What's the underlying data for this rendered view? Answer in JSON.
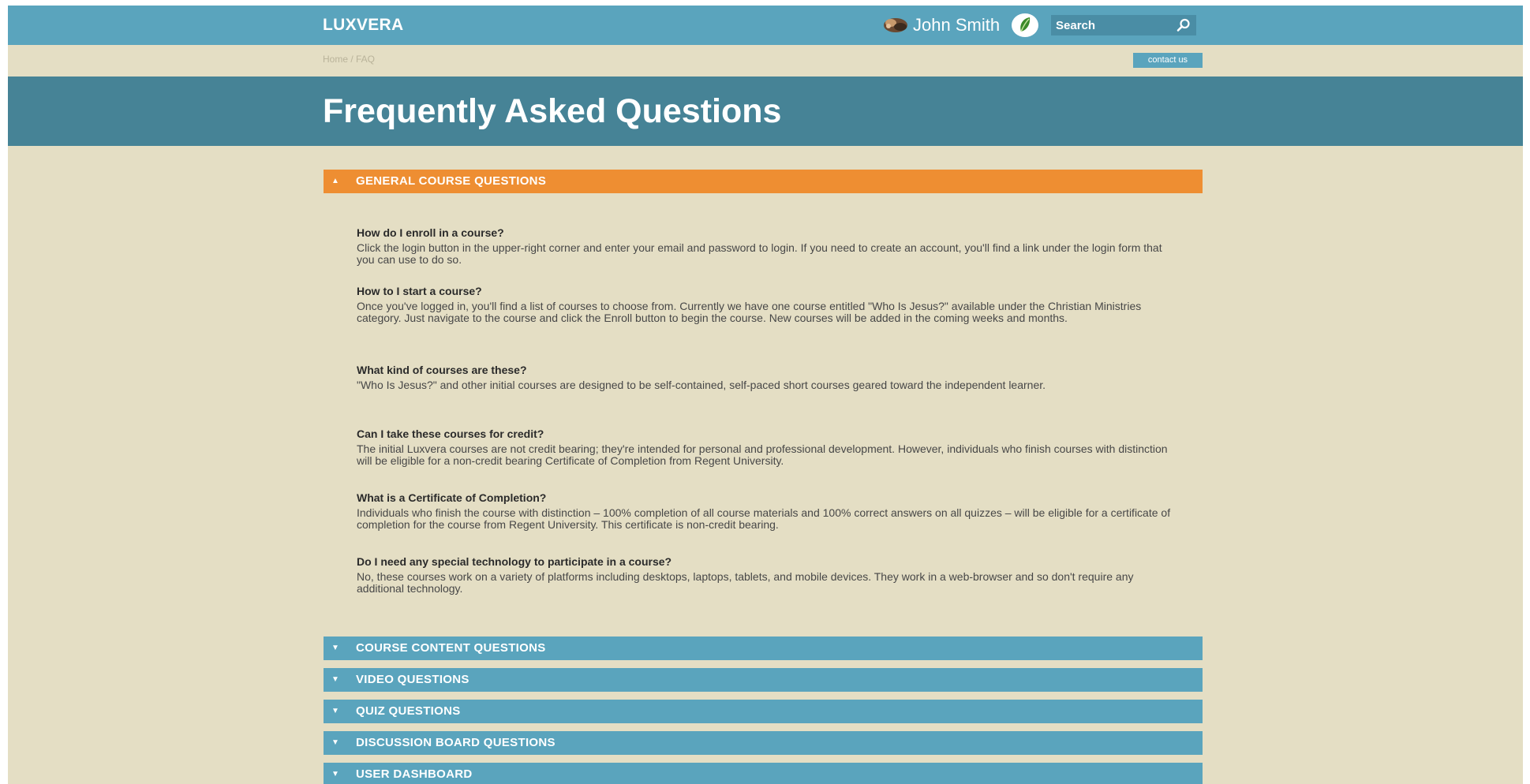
{
  "header": {
    "logo": "LUXVERA",
    "user_name": "John Smith",
    "search_placeholder": "Search"
  },
  "breadcrumb": "Home / FAQ",
  "contact_label": "contact us",
  "page_title": "Frequently Asked Questions",
  "sections": [
    {
      "label": "GENERAL COURSE QUESTIONS",
      "expanded": true,
      "items": [
        {
          "q": "How do I enroll in a course?",
          "a": "Click the login button in the upper-right corner and enter your email and password to login. If you need to create an account, you'll find a link under the login form that you can use to do so."
        },
        {
          "q": "How to I start a course?",
          "a": "Once you've logged in, you'll find a list of courses to choose from. Currently we have one course entitled \"Who Is Jesus?\" available under the Christian Ministries category. Just navigate to the course and click the Enroll button to begin the course. New courses will be added in the coming weeks and months."
        },
        {
          "q": "What kind of courses are these?",
          "a": "\"Who Is Jesus?\" and other initial courses are designed to be self-contained, self-paced short courses geared toward the independent learner."
        },
        {
          "q": "Can I take these courses for credit?",
          "a": "The initial Luxvera courses are not credit bearing; they're intended for personal and professional development. However, individuals who finish courses with distinction will be eligible for a non-credit bearing Certificate of Completion from Regent University."
        },
        {
          "q": "What is a Certificate of Completion?",
          "a": "Individuals who finish the course with distinction – 100% completion of all course materials and 100% correct answers on all quizzes – will be eligible for a certificate of completion for the course from Regent University. This certificate is non-credit bearing."
        },
        {
          "q": "Do I need any special technology to participate in a course?",
          "a": "No, these courses work on a variety of platforms including desktops, laptops, tablets, and mobile devices. They work in a web-browser and so don't require any additional technology."
        }
      ]
    },
    {
      "label": "COURSE CONTENT QUESTIONS",
      "expanded": false
    },
    {
      "label": "VIDEO QUESTIONS",
      "expanded": false
    },
    {
      "label": "QUIZ QUESTIONS",
      "expanded": false
    },
    {
      "label": "DISCUSSION BOARD QUESTIONS",
      "expanded": false
    },
    {
      "label": "USER DASHBOARD",
      "expanded": false
    }
  ],
  "icons": {
    "expanded_arrow": "arrow-up-icon",
    "collapsed_arrow": "arrow-down-icon",
    "avatar": "avatar-icon",
    "badge": "leaf-icon",
    "search": "search-icon"
  },
  "colors": {
    "topbar": "#5aa4bd",
    "hero": "#468396",
    "background": "#e4dec4",
    "active_section": "#ee8e32",
    "section": "#5aa4bd"
  }
}
